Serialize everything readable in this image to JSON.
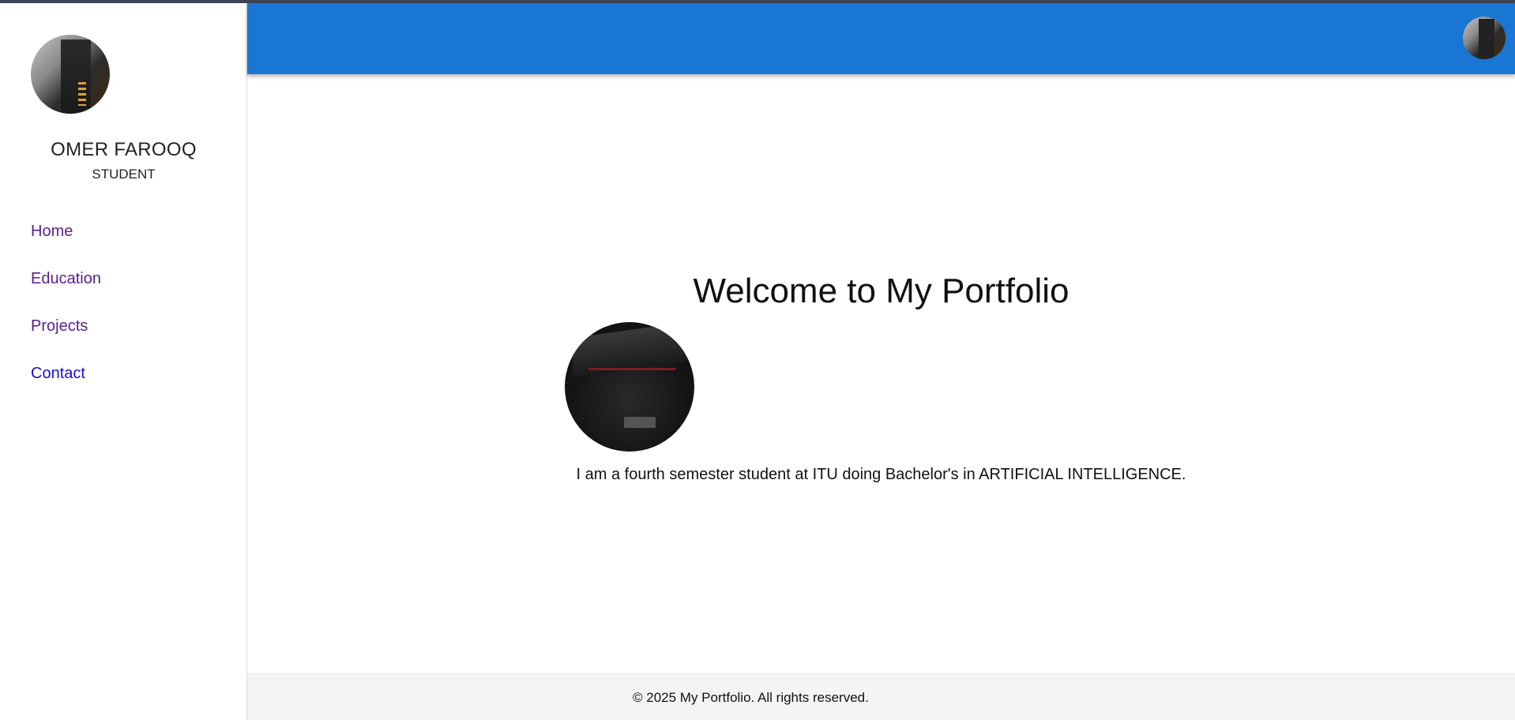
{
  "profile": {
    "name": "OMER FAROOQ",
    "role": "STUDENT",
    "avatar_icon": "profile-photo"
  },
  "nav": {
    "items": [
      {
        "label": "Home",
        "color": "#5a1f8a"
      },
      {
        "label": "Education",
        "color": "#5a1f8a"
      },
      {
        "label": "Projects",
        "color": "#5a1f8a"
      },
      {
        "label": "Contact",
        "color": "#1a0dce"
      }
    ]
  },
  "header": {
    "background": "#1976d2",
    "avatar_icon": "profile-photo"
  },
  "main": {
    "title": "Welcome to My Portfolio",
    "photo_icon": "car-photo",
    "intro": "I am a fourth semester student at ITU doing Bachelor's in ARTIFICIAL INTELLIGENCE."
  },
  "footer": {
    "text": "© 2025 My Portfolio. All rights reserved."
  }
}
